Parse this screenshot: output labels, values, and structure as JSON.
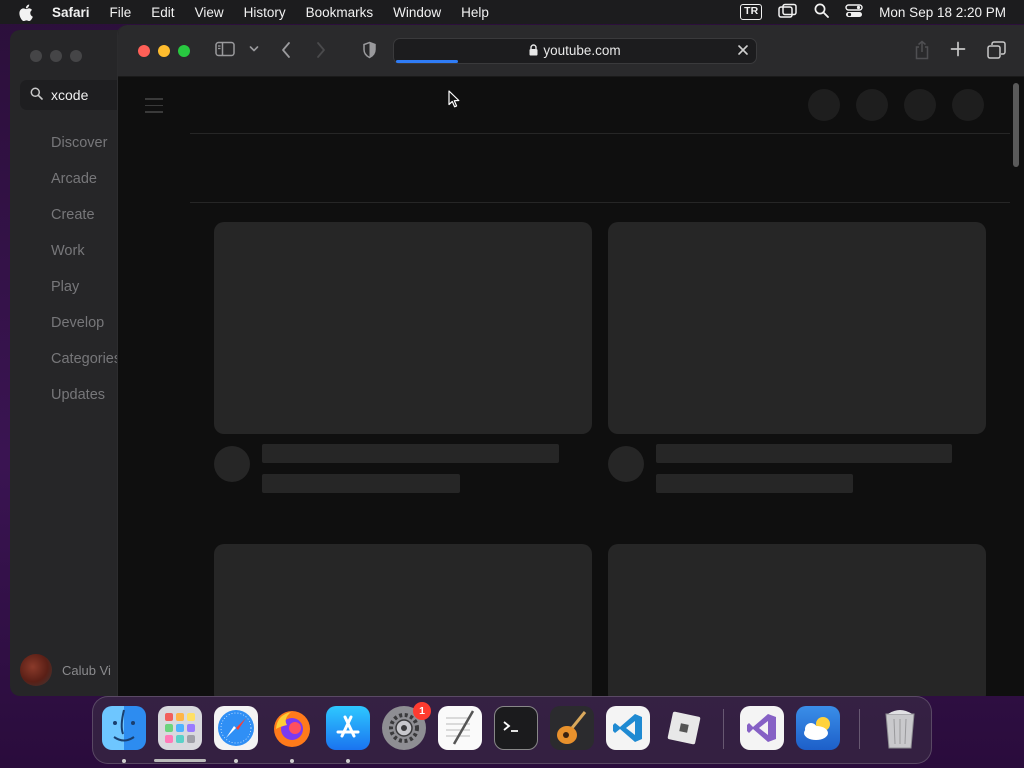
{
  "menubar": {
    "app_name": "Safari",
    "items": [
      "File",
      "Edit",
      "View",
      "History",
      "Bookmarks",
      "Window",
      "Help"
    ],
    "input_source": "TR",
    "clock": "Mon Sep 18  2:20 PM"
  },
  "appstore": {
    "search_value": "xcode",
    "nav": [
      "Discover",
      "Arcade",
      "Create",
      "Work",
      "Play",
      "Develop",
      "Categories",
      "Updates"
    ],
    "user_name": "Calub Vi"
  },
  "safari": {
    "url": "youtube.com",
    "load_progress": 0.17
  },
  "dock": {
    "apps": [
      {
        "name": "Finder",
        "icon": "finder-icon",
        "running": true
      },
      {
        "name": "Launchpad",
        "icon": "launchpad-icon",
        "running": false
      },
      {
        "name": "Safari",
        "icon": "safari-icon",
        "running": true
      },
      {
        "name": "Firefox",
        "icon": "firefox-icon",
        "running": true
      },
      {
        "name": "App Store",
        "icon": "app-store-icon",
        "running": true
      },
      {
        "name": "System Settings",
        "icon": "gear-icon",
        "running": false,
        "badge": "1"
      },
      {
        "name": "TextEdit",
        "icon": "textedit-icon",
        "running": false
      },
      {
        "name": "Terminal",
        "icon": "terminal-icon",
        "running": false
      },
      {
        "name": "GarageBand",
        "icon": "guitar-icon",
        "running": false
      },
      {
        "name": "Visual Studio Code",
        "icon": "vscode-icon",
        "running": false
      },
      {
        "name": "Roblox",
        "icon": "roblox-icon",
        "running": false
      },
      {
        "name": "Visual Studio",
        "icon": "visual-studio-icon",
        "running": false
      },
      {
        "name": "Weather",
        "icon": "weather-icon",
        "running": false
      },
      {
        "name": "Trash",
        "icon": "trash-icon",
        "running": false
      }
    ]
  },
  "colors": {
    "accent": "#2f7cf6",
    "close": "#fe5f57",
    "minimize": "#febc2e",
    "zoom": "#28c840",
    "badge": "#ff3b30"
  }
}
